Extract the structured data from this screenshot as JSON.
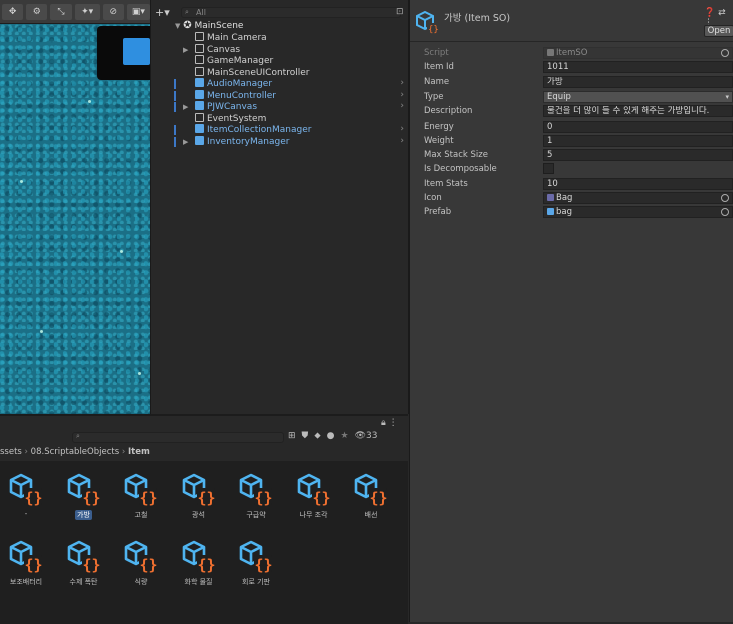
{
  "scene_toolbar": {
    "icons": [
      "move-tool-icon",
      "settings-icon",
      "scene-gizmo-icon",
      "visibility-icon",
      "camera-icon"
    ]
  },
  "hierarchy": {
    "search_placeholder": "All",
    "root": "MainScene",
    "items": [
      {
        "label": "Main Camera",
        "prefab": false,
        "expandable": false
      },
      {
        "label": "Canvas",
        "prefab": false,
        "expandable": true
      },
      {
        "label": "GameManager",
        "prefab": false,
        "expandable": false
      },
      {
        "label": "MainSceneUIController",
        "prefab": false,
        "expandable": false
      },
      {
        "label": "AudioManager",
        "prefab": true,
        "expandable": false
      },
      {
        "label": "MenuController",
        "prefab": true,
        "expandable": false
      },
      {
        "label": "PJWCanvas",
        "prefab": true,
        "expandable": true
      },
      {
        "label": "EventSystem",
        "prefab": false,
        "expandable": false
      },
      {
        "label": "ItemCollectionManager",
        "prefab": true,
        "expandable": false
      },
      {
        "label": "InventoryManager",
        "prefab": true,
        "expandable": true
      }
    ]
  },
  "inspector": {
    "title": "가방 (Item SO)",
    "open_label": "Open",
    "fields": [
      {
        "label": "Script",
        "value": "ItemSO",
        "kind": "disabled"
      },
      {
        "label": "Item Id",
        "value": "1011",
        "kind": "text"
      },
      {
        "label": "Name",
        "value": "가방",
        "kind": "text"
      },
      {
        "label": "Type",
        "value": "Equip",
        "kind": "dropdown"
      },
      {
        "label": "Description",
        "value": "물건을 더 많이 들 수 있게 해주는 가방입니다.",
        "kind": "text"
      },
      {
        "label": "Energy",
        "value": "0",
        "kind": "text"
      },
      {
        "label": "Weight",
        "value": "1",
        "kind": "text"
      },
      {
        "label": "Max Stack Size",
        "value": "5",
        "kind": "text"
      },
      {
        "label": "Is Decomposable",
        "value": "",
        "kind": "checkbox"
      },
      {
        "label": "Item Stats",
        "value": "10",
        "kind": "text"
      },
      {
        "label": "Icon",
        "value": "Bag",
        "kind": "object"
      },
      {
        "label": "Prefab",
        "value": "bag",
        "kind": "object"
      }
    ]
  },
  "project": {
    "breadcrumb": [
      "ssets",
      "08.ScriptableObjects",
      "Item"
    ],
    "count": "33",
    "assets": [
      {
        "label": "-",
        "selected": false
      },
      {
        "label": "가방",
        "selected": true
      },
      {
        "label": "고철",
        "selected": false
      },
      {
        "label": "광석",
        "selected": false
      },
      {
        "label": "구급약",
        "selected": false
      },
      {
        "label": "나무 조각",
        "selected": false
      },
      {
        "label": "배선",
        "selected": false
      },
      {
        "label": "보조배터리",
        "selected": false
      },
      {
        "label": "수제 폭탄",
        "selected": false
      },
      {
        "label": "식량",
        "selected": false
      },
      {
        "label": "화학 물질",
        "selected": false
      },
      {
        "label": "회로 기판",
        "selected": false
      }
    ]
  },
  "colors": {
    "prefab_blue": "#7bb6ee",
    "asset_blue": "#4fb4f0",
    "asset_orange": "#f07030",
    "selection": "#3b5e8e"
  }
}
